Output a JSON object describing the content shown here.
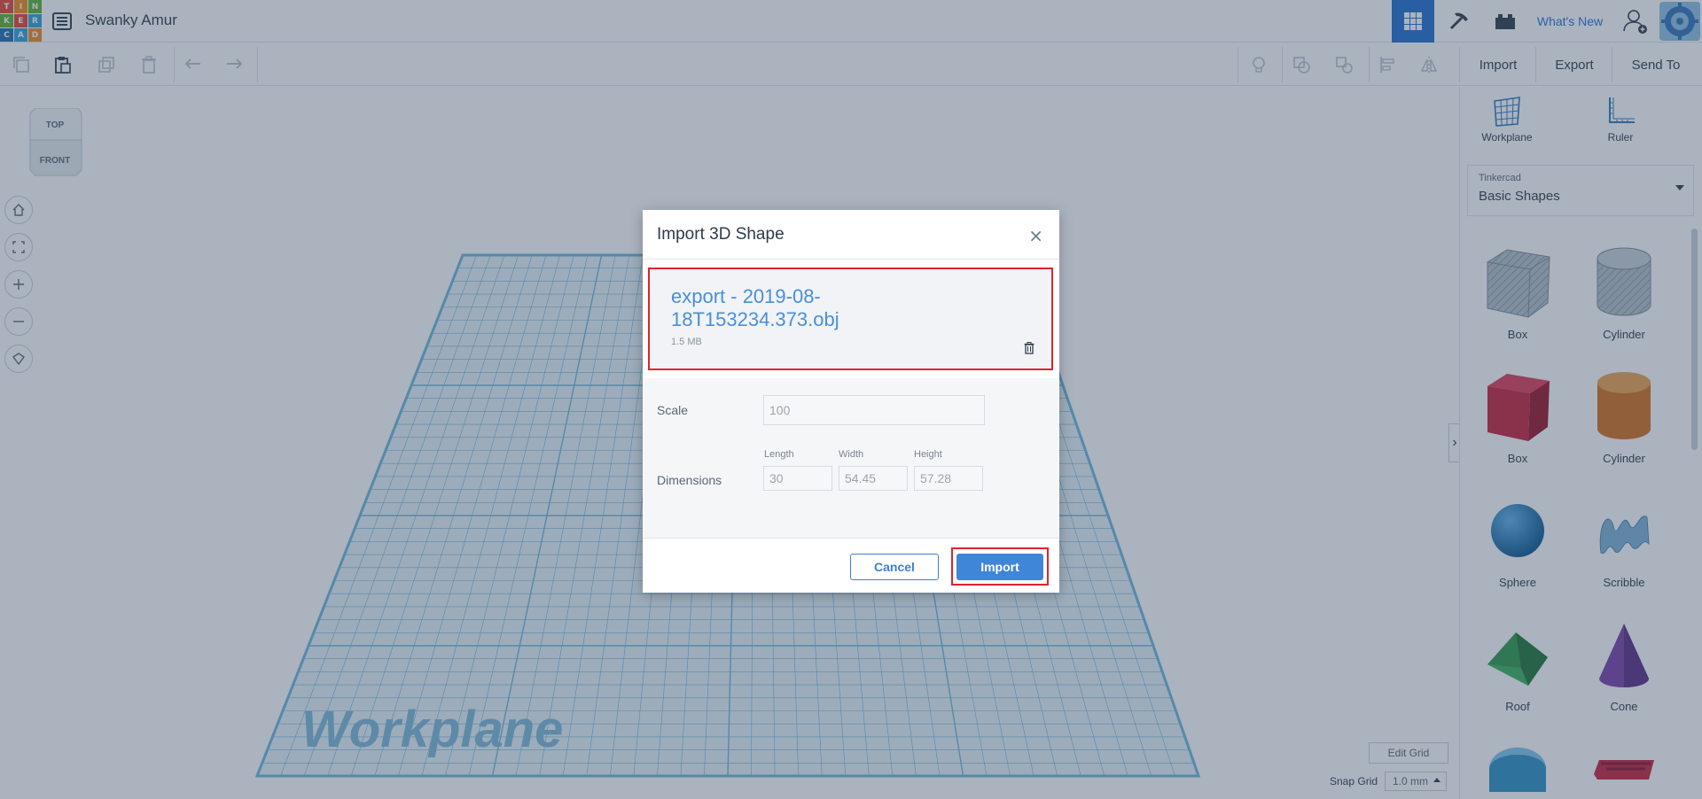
{
  "app": {
    "logo_letters": [
      "T",
      "I",
      "N",
      "K",
      "E",
      "R",
      "C",
      "A",
      "D"
    ],
    "design_title": "Swanky Amur",
    "whats_new": "What's New"
  },
  "toolbar": {
    "import_label": "Import",
    "export_label": "Export",
    "send_to_label": "Send To"
  },
  "canvas": {
    "viewcube_top": "TOP",
    "viewcube_front": "FRONT",
    "workplane_label": "Workplane",
    "edit_grid": "Edit Grid",
    "snap_grid_label": "Snap Grid",
    "snap_grid_value": "1.0 mm"
  },
  "panel": {
    "workplane_tool": "Workplane",
    "ruler_tool": "Ruler",
    "library_source": "Tinkercad",
    "library_name": "Basic Shapes",
    "shapes": [
      {
        "label": "Box",
        "color": "#9aa6b2"
      },
      {
        "label": "Cylinder",
        "color": "#a8b3be"
      },
      {
        "label": "Box",
        "color": "#c8203b"
      },
      {
        "label": "Cylinder",
        "color": "#e07b24"
      },
      {
        "label": "Sphere",
        "color": "#1a7fc2"
      },
      {
        "label": "Scribble",
        "color": "#6ea6cf"
      },
      {
        "label": "Roof",
        "color": "#2e9a4a"
      },
      {
        "label": "Cone",
        "color": "#7b3fa7"
      }
    ]
  },
  "modal": {
    "title": "Import 3D Shape",
    "close": "×",
    "file_name": "export - 2019-08-18T153234.373.obj",
    "file_size": "1.5 MB",
    "scale_label": "Scale",
    "scale_value": "100",
    "dimensions_label": "Dimensions",
    "length_label": "Length",
    "width_label": "Width",
    "height_label": "Height",
    "length_value": "30",
    "width_value": "54.45",
    "height_value": "57.28",
    "cancel_label": "Cancel",
    "import_label": "Import"
  },
  "colors": {
    "accent": "#1f6fd1",
    "highlight_border": "#e0232a",
    "workplane_grid": "#6fb7dd"
  }
}
